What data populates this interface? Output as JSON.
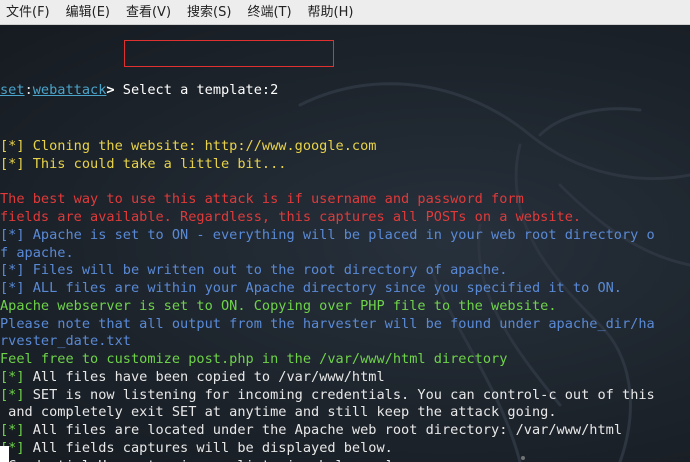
{
  "menu": [
    {
      "label": "文件(F)"
    },
    {
      "label": "编辑(E)"
    },
    {
      "label": "查看(V)"
    },
    {
      "label": "搜索(S)"
    },
    {
      "label": "终端(T)"
    },
    {
      "label": "帮助(H)"
    }
  ],
  "prompt": {
    "prefix": "set",
    "colon": ":",
    "module": "webattack",
    "gt": "> ",
    "input": "Select a template:2"
  },
  "lines": [
    {
      "text": "[*] Cloning the website: http://www.google.com",
      "color": "yellow"
    },
    {
      "text": "[*] This could take a little bit...",
      "color": "yellow"
    },
    {
      "text": "",
      "color": "gap"
    },
    {
      "text": "The best way to use this attack is if username and password form",
      "color": "red"
    },
    {
      "text": "fields are available. Regardless, this captures all POSTs on a website.",
      "color": "red"
    },
    {
      "text": "[*] Apache is set to ON - everything will be placed in your web root directory o",
      "color": "blue"
    },
    {
      "text": "f apache.",
      "color": "blue"
    },
    {
      "text": "[*] Files will be written out to the root directory of apache.",
      "color": "blue"
    },
    {
      "text": "[*] ALL files are within your Apache directory since you specified it to ON.",
      "color": "blue"
    },
    {
      "text": "Apache webserver is set to ON. Copying over PHP file to the website.",
      "color": "green"
    },
    {
      "text": "Please note that all output from the harvester will be found under apache_dir/ha",
      "color": "blue"
    },
    {
      "text": "rvester_date.txt",
      "color": "blue"
    },
    {
      "text": "Feel free to customize post.php in the /var/www/html directory",
      "color": "green"
    },
    {
      "tag": "[*]",
      "rest": " All files have been copied to /var/www/html",
      "color": "mixed"
    },
    {
      "tag": "[*]",
      "rest": " SET is now listening for incoming credentials. You can control-c out of this",
      "color": "mixed"
    },
    {
      "text": " and completely exit SET at anytime and still keep the attack going.",
      "color": "white"
    },
    {
      "tag": "[*]",
      "rest": " All files are located under the Apache web root directory: /var/www/html",
      "color": "mixed"
    },
    {
      "tag": "[*]",
      "rest": " All fields captures will be displayed below.",
      "color": "mixed"
    },
    {
      "text": "[Credential Harvester is now listening below...]",
      "color": "white"
    }
  ],
  "colors": {
    "yellow": "#e8d34a",
    "red": "#e03a3a",
    "blue": "#5a8ad6",
    "green": "#6fd34a",
    "white": "#e8e8e8",
    "highlight_box": "#e03030"
  }
}
